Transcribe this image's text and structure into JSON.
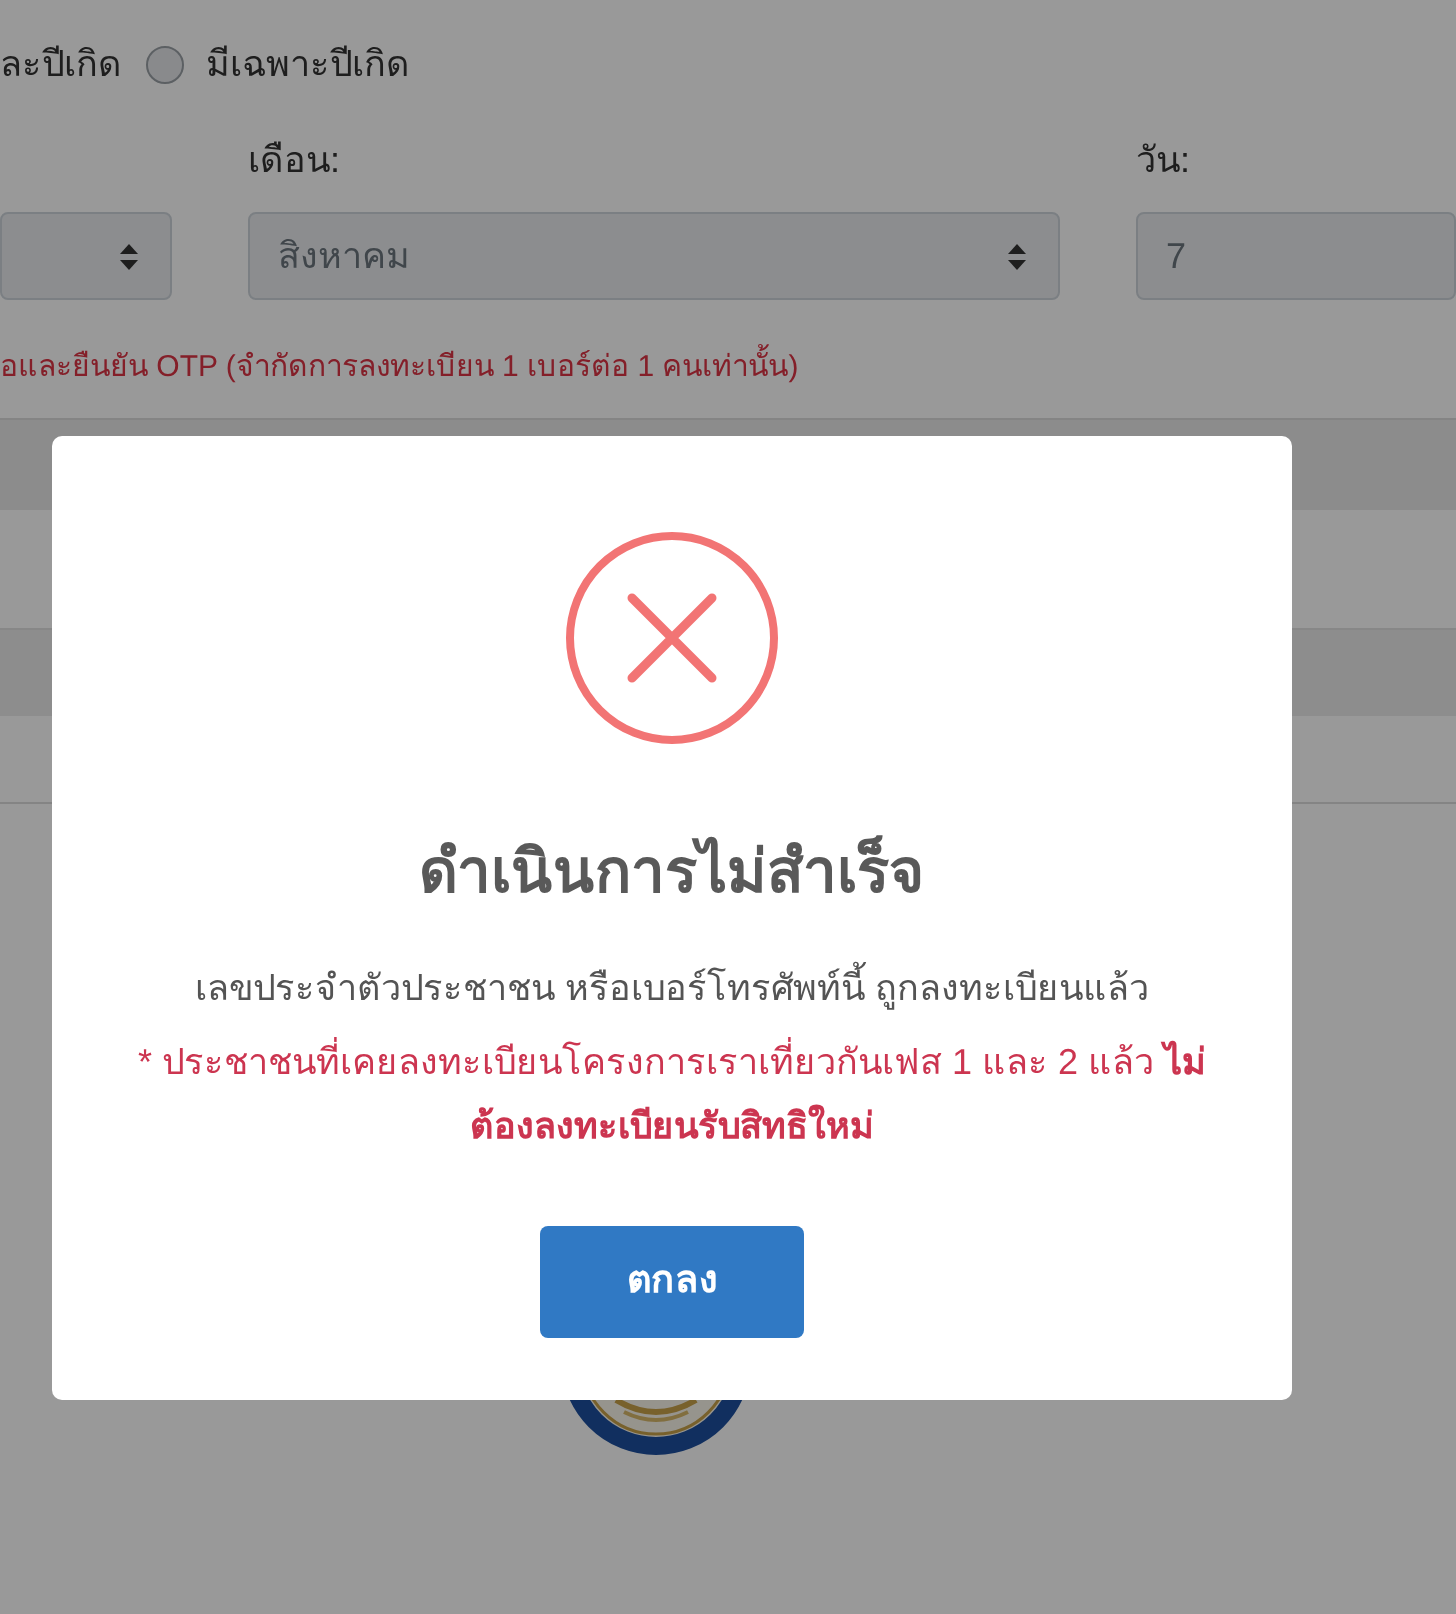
{
  "page": {
    "birth_mode": {
      "cut_label": "ละปีเกิด",
      "option": {
        "label": "มีเฉพาะปีเกิด",
        "selected": false
      }
    },
    "fields": [
      {
        "kind": "select",
        "disabled": true
      },
      {
        "kind": "select",
        "label": "เดือน:",
        "value": "สิงหาคม",
        "disabled": true
      },
      {
        "kind": "input",
        "label": "วัน:",
        "value": "7",
        "disabled": true
      }
    ],
    "otp_note": "อและยืนยัน OTP (จำกัดการลงทะเบียน 1 เบอร์ต่อ 1 คนเท่านั้น)"
  },
  "dialog": {
    "kind": "error",
    "title": "ดำเนินการไม่สำเร็จ",
    "message": "เลขประจำตัวประชาชน หรือเบอร์โทรศัพท์นี้ ถูกลงทะเบียนแล้ว",
    "note": "* ประชาชนที่เคยลงทะเบียนโครงการเราเที่ยวกันเฟส 1 และ 2 แล้ว **ไม่ต้องลงทะเบียนรับสิทธิใหม่**",
    "buttons": [
      {
        "label": "ตกลง"
      }
    ]
  }
}
